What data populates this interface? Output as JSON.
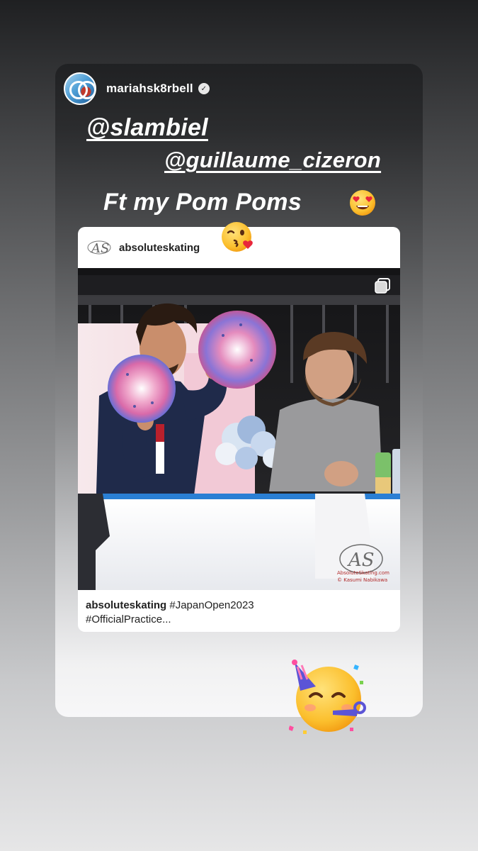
{
  "story": {
    "username": "mariahsk8rbell",
    "verified_symbol": "✓",
    "mentions": [
      "@slambiel",
      "@guillaume_cizeron"
    ],
    "caption": "Ft my Pom Poms"
  },
  "stickers": {
    "heart_eyes": "heart-eyes-emoji",
    "kiss": "blowing-kiss-emoji",
    "party": "partying-face-emoji"
  },
  "post": {
    "account": "absoluteskating",
    "logo_text": "AS",
    "caption_account": "absoluteskating",
    "caption_line1": " #JapanOpen2023",
    "caption_line2": "#OfficialPractice...",
    "watermark_site": "AbsoluteSkating.com",
    "watermark_credit": "© Kasumi Nabikawa",
    "multi_image_icon": "carousel-icon"
  },
  "colors": {
    "story_text": "#ffffff",
    "post_bg": "#ffffff",
    "rink_barrier": "#ffffff",
    "barrier_trim": "#2a7fd4",
    "pompom_pink": "#e86aa5",
    "pompom_blue": "#5b6fd8"
  }
}
